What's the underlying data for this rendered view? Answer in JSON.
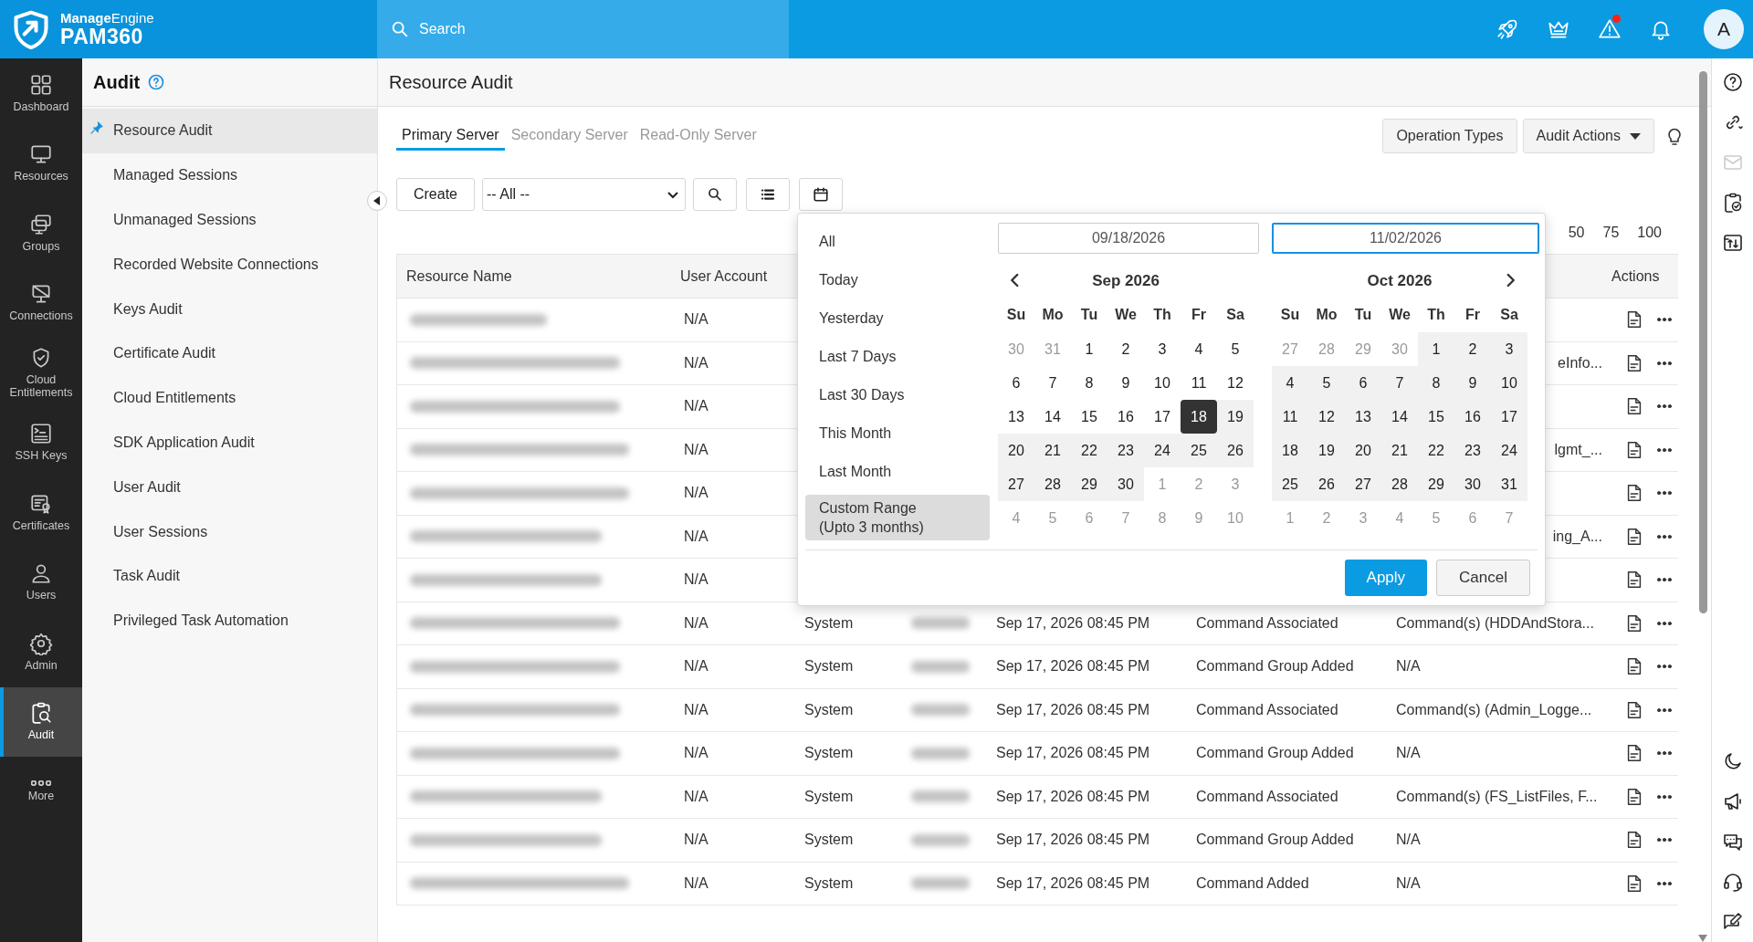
{
  "topbar": {
    "brand": "**Manage**Engine",
    "product": "PAM360",
    "search_placeholder": "Search",
    "avatar": "A",
    "icons": [
      {
        "badge": false
      },
      {
        "badge": false
      },
      {
        "badge": true
      },
      {
        "badge": false
      }
    ]
  },
  "rail": [
    {
      "label": "Dashboard",
      "selected": false
    },
    {
      "label": "Resources",
      "selected": false
    },
    {
      "label": "Groups",
      "selected": false
    },
    {
      "label": "Connections",
      "selected": false
    },
    {
      "label": "Cloud Entitlements",
      "selected": false
    },
    {
      "label": "SSH Keys",
      "selected": false
    },
    {
      "label": "Certificates",
      "selected": false
    },
    {
      "label": "Users",
      "selected": false
    },
    {
      "label": "Admin",
      "selected": false
    },
    {
      "label": "Audit",
      "selected": true
    },
    {
      "label": "More",
      "selected": false
    }
  ],
  "subnav": {
    "title": "Audit",
    "items": [
      {
        "label": "Resource Audit",
        "selected": true,
        "pinned": true
      },
      {
        "label": "Managed Sessions",
        "selected": false,
        "pinned": false
      },
      {
        "label": "Unmanaged Sessions",
        "selected": false,
        "pinned": false
      },
      {
        "label": "Recorded Website Connections",
        "selected": false,
        "pinned": false
      },
      {
        "label": "Keys Audit",
        "selected": false,
        "pinned": false
      },
      {
        "label": "Certificate Audit",
        "selected": false,
        "pinned": false
      },
      {
        "label": "Cloud Entitlements",
        "selected": false,
        "pinned": false
      },
      {
        "label": "SDK Application Audit",
        "selected": false,
        "pinned": false
      },
      {
        "label": "User Audit",
        "selected": false,
        "pinned": false
      },
      {
        "label": "User Sessions",
        "selected": false,
        "pinned": false
      },
      {
        "label": "Task Audit",
        "selected": false,
        "pinned": false
      },
      {
        "label": "Privileged Task Automation",
        "selected": false,
        "pinned": false
      }
    ]
  },
  "page": {
    "title": "Resource Audit",
    "tabs": [
      {
        "label": "Primary Server",
        "selected": true
      },
      {
        "label": "Secondary Server",
        "selected": false
      },
      {
        "label": "Read-Only Server",
        "selected": false
      }
    ],
    "operation_types": "Operation Types",
    "audit_actions": "Audit Actions",
    "create": "Create",
    "filter": "-- All --",
    "page_sizes": [
      "50",
      "75",
      "100"
    ],
    "table": {
      "columns": [
        "Resource Name",
        "User Account",
        "Actions"
      ],
      "rows": [
        {
          "user_account": "N/A"
        },
        {
          "user_account": "N/A",
          "details": "eInfo..."
        },
        {
          "user_account": "N/A"
        },
        {
          "user_account": "N/A",
          "details": "lgmt_..."
        },
        {
          "user_account": "N/A"
        },
        {
          "user_account": "N/A",
          "details": "ing_A..."
        },
        {
          "user_account": "N/A"
        },
        {
          "user_account": "N/A",
          "user": "System",
          "time": "Sep 17, 2026 08:45 PM",
          "operation": "Command Associated",
          "details": "Command(s) (HDDAndStora..."
        },
        {
          "user_account": "N/A",
          "user": "System",
          "time": "Sep 17, 2026 08:45 PM",
          "operation": "Command Group Added",
          "details": "N/A"
        },
        {
          "user_account": "N/A",
          "user": "System",
          "time": "Sep 17, 2026 08:45 PM",
          "operation": "Command Associated",
          "details": "Command(s) (Admin_Logge..."
        },
        {
          "user_account": "N/A",
          "user": "System",
          "time": "Sep 17, 2026 08:45 PM",
          "operation": "Command Group Added",
          "details": "N/A"
        },
        {
          "user_account": "N/A",
          "user": "System",
          "time": "Sep 17, 2026 08:45 PM",
          "operation": "Command Associated",
          "details": "Command(s) (FS_ListFiles, F..."
        },
        {
          "user_account": "N/A",
          "user": "System",
          "time": "Sep 17, 2026 08:45 PM",
          "operation": "Command Group Added",
          "details": "N/A"
        },
        {
          "user_account": "N/A",
          "user": "System",
          "time": "Sep 17, 2026 08:45 PM",
          "operation": "Command Added",
          "details": "N/A"
        }
      ]
    },
    "date_picker": {
      "presets": [
        {
          "label": "All",
          "selected": false
        },
        {
          "label": "Today",
          "selected": false
        },
        {
          "label": "Yesterday",
          "selected": false
        },
        {
          "label": "Last 7 Days",
          "selected": false
        },
        {
          "label": "Last 30 Days",
          "selected": false
        },
        {
          "label": "This Month",
          "selected": false
        },
        {
          "label": "Last Month",
          "selected": false
        },
        {
          "label": "Custom Range",
          "note": "(Upto 3 months)",
          "selected": true
        }
      ],
      "inputs": [
        {
          "value": "09/18/2026",
          "focused": false
        },
        {
          "value": "11/02/2026",
          "focused": true
        }
      ],
      "months": [
        {
          "title": "Sep 2026",
          "weekdays": [
            "Su",
            "Mo",
            "Tu",
            "We",
            "Th",
            "Fr",
            "Sa"
          ],
          "weeks": [
            [
              {
                "d": "30",
                "kind": "other"
              },
              {
                "d": "31",
                "kind": "other"
              },
              {
                "d": "1",
                "kind": "day"
              },
              {
                "d": "2",
                "kind": "day"
              },
              {
                "d": "3",
                "kind": "day"
              },
              {
                "d": "4",
                "kind": "day"
              },
              {
                "d": "5",
                "kind": "day"
              }
            ],
            [
              {
                "d": "6",
                "kind": "day"
              },
              {
                "d": "7",
                "kind": "day"
              },
              {
                "d": "8",
                "kind": "day"
              },
              {
                "d": "9",
                "kind": "day"
              },
              {
                "d": "10",
                "kind": "day"
              },
              {
                "d": "11",
                "kind": "day"
              },
              {
                "d": "12",
                "kind": "day"
              }
            ],
            [
              {
                "d": "13",
                "kind": "day"
              },
              {
                "d": "14",
                "kind": "day"
              },
              {
                "d": "15",
                "kind": "day"
              },
              {
                "d": "16",
                "kind": "day"
              },
              {
                "d": "17",
                "kind": "day"
              },
              {
                "d": "18",
                "kind": "start"
              },
              {
                "d": "19",
                "kind": "range"
              }
            ],
            [
              {
                "d": "20",
                "kind": "range"
              },
              {
                "d": "21",
                "kind": "range"
              },
              {
                "d": "22",
                "kind": "range"
              },
              {
                "d": "23",
                "kind": "range"
              },
              {
                "d": "24",
                "kind": "range"
              },
              {
                "d": "25",
                "kind": "range"
              },
              {
                "d": "26",
                "kind": "range"
              }
            ],
            [
              {
                "d": "27",
                "kind": "range"
              },
              {
                "d": "28",
                "kind": "range"
              },
              {
                "d": "29",
                "kind": "range"
              },
              {
                "d": "30",
                "kind": "range"
              },
              {
                "d": "1",
                "kind": "other"
              },
              {
                "d": "2",
                "kind": "other"
              },
              {
                "d": "3",
                "kind": "other"
              }
            ],
            [
              {
                "d": "4",
                "kind": "other"
              },
              {
                "d": "5",
                "kind": "other"
              },
              {
                "d": "6",
                "kind": "other"
              },
              {
                "d": "7",
                "kind": "other"
              },
              {
                "d": "8",
                "kind": "other"
              },
              {
                "d": "9",
                "kind": "other"
              },
              {
                "d": "10",
                "kind": "other"
              }
            ]
          ]
        },
        {
          "title": "Oct 2026",
          "weekdays": [
            "Su",
            "Mo",
            "Tu",
            "We",
            "Th",
            "Fr",
            "Sa"
          ],
          "weeks": [
            [
              {
                "d": "27",
                "kind": "other"
              },
              {
                "d": "28",
                "kind": "other"
              },
              {
                "d": "29",
                "kind": "other"
              },
              {
                "d": "30",
                "kind": "other"
              },
              {
                "d": "1",
                "kind": "range"
              },
              {
                "d": "2",
                "kind": "range"
              },
              {
                "d": "3",
                "kind": "range"
              }
            ],
            [
              {
                "d": "4",
                "kind": "range"
              },
              {
                "d": "5",
                "kind": "range"
              },
              {
                "d": "6",
                "kind": "range"
              },
              {
                "d": "7",
                "kind": "range"
              },
              {
                "d": "8",
                "kind": "range"
              },
              {
                "d": "9",
                "kind": "range"
              },
              {
                "d": "10",
                "kind": "range"
              }
            ],
            [
              {
                "d": "11",
                "kind": "range"
              },
              {
                "d": "12",
                "kind": "range"
              },
              {
                "d": "13",
                "kind": "range"
              },
              {
                "d": "14",
                "kind": "range"
              },
              {
                "d": "15",
                "kind": "range"
              },
              {
                "d": "16",
                "kind": "range"
              },
              {
                "d": "17",
                "kind": "range"
              }
            ],
            [
              {
                "d": "18",
                "kind": "range"
              },
              {
                "d": "19",
                "kind": "range"
              },
              {
                "d": "20",
                "kind": "range"
              },
              {
                "d": "21",
                "kind": "range"
              },
              {
                "d": "22",
                "kind": "range"
              },
              {
                "d": "23",
                "kind": "range"
              },
              {
                "d": "24",
                "kind": "range"
              }
            ],
            [
              {
                "d": "25",
                "kind": "range"
              },
              {
                "d": "26",
                "kind": "range"
              },
              {
                "d": "27",
                "kind": "range"
              },
              {
                "d": "28",
                "kind": "range"
              },
              {
                "d": "29",
                "kind": "range"
              },
              {
                "d": "30",
                "kind": "range"
              },
              {
                "d": "31",
                "kind": "range"
              }
            ],
            [
              {
                "d": "1",
                "kind": "other"
              },
              {
                "d": "2",
                "kind": "other"
              },
              {
                "d": "3",
                "kind": "other"
              },
              {
                "d": "4",
                "kind": "other"
              },
              {
                "d": "5",
                "kind": "other"
              },
              {
                "d": "6",
                "kind": "other"
              },
              {
                "d": "7",
                "kind": "other"
              }
            ]
          ]
        }
      ],
      "apply": "Apply",
      "cancel": "Cancel"
    }
  },
  "right_rail": {
    "top": [
      {
        "disabled": false
      },
      {
        "disabled": false
      },
      {
        "disabled": true
      },
      {
        "disabled": false
      },
      {
        "disabled": false
      }
    ],
    "bottom": [
      {
        "disabled": false
      },
      {
        "disabled": false
      },
      {
        "disabled": false
      },
      {
        "disabled": false
      },
      {
        "disabled": false
      }
    ]
  }
}
